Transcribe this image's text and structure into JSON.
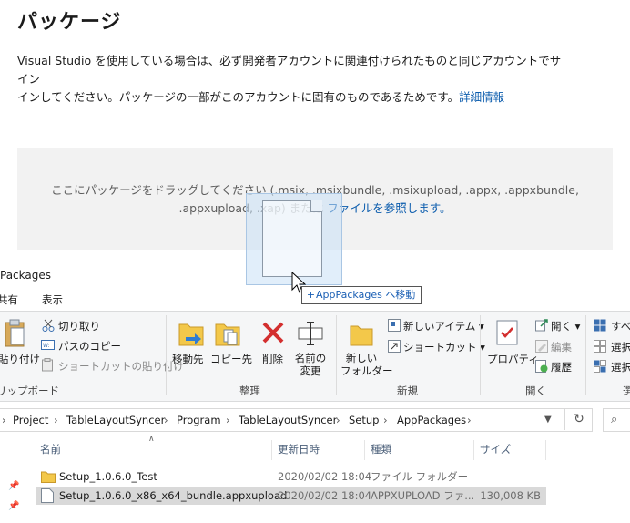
{
  "page": {
    "title": "パッケージ",
    "desc_line1": "Visual Studio を使用している場合は、必ず開発者アカウントに関連付けられたものと同じアカウントでサイン",
    "desc_line2": "インしてください。パッケージの一部がこのアカウントに固有のものであるためです。",
    "desc_link": "詳細情報"
  },
  "dropzone": {
    "line1": "ここにパッケージをドラッグしてください (.msix, .msixbundle, .msixupload, .appx, .appxbundle,",
    "line2_prefix": ".appxupload, .xap) または ",
    "line2_link": "ファイルを参照します。"
  },
  "drag": {
    "tooltip": "AppPackages へ移動",
    "plus": "+"
  },
  "explorer": {
    "title": "Packages",
    "tabs": [
      "共有",
      "表示"
    ],
    "ribbon": {
      "clipboard": {
        "paste": "貼り付け",
        "cut": "切り取り",
        "copy_path": "パスのコピー",
        "paste_shortcut": "ショートカットの貼り付け",
        "group": "リップボード"
      },
      "organize": {
        "move_to": "移動先",
        "copy_to": "コピー先",
        "delete": "削除",
        "rename_line1": "名前の",
        "rename_line2": "変更",
        "group": "整理"
      },
      "new": {
        "new_folder_line1": "新しい",
        "new_folder_line2": "フォルダー",
        "new_item": "新しいアイテム",
        "shortcut": "ショートカット",
        "group": "新規"
      },
      "open": {
        "properties": "プロパティ",
        "open": "開く",
        "edit": "編集",
        "history": "履歴",
        "group": "開く"
      },
      "select": {
        "all": "すべ",
        "none": "選択",
        "invert": "選択",
        "group": "選"
      }
    },
    "address": {
      "segments": [
        "Project",
        "TableLayoutSyncer",
        "Program",
        "TableLayoutSyncer",
        "Setup",
        "AppPackages"
      ]
    },
    "columns": {
      "name": "名前",
      "date": "更新日時",
      "type": "種類",
      "size": "サイズ"
    },
    "files": [
      {
        "name": "Setup_1.0.6.0_Test",
        "date": "2020/02/02 18:04",
        "type": "ファイル フォルダー",
        "size": ""
      },
      {
        "name": "Setup_1.0.6.0_x86_x64_bundle.appxupload",
        "date": "2020/02/02 18:04",
        "type": "APPXUPLOAD ファ...",
        "size": "130,008 KB"
      }
    ]
  },
  "colors": {
    "link": "#0b5cad",
    "dropzone_bg": "#f2f2f2",
    "ribbon_bg": "#f5f6f7",
    "selection": "#d9d9d9",
    "folder": "#f3c84a"
  }
}
